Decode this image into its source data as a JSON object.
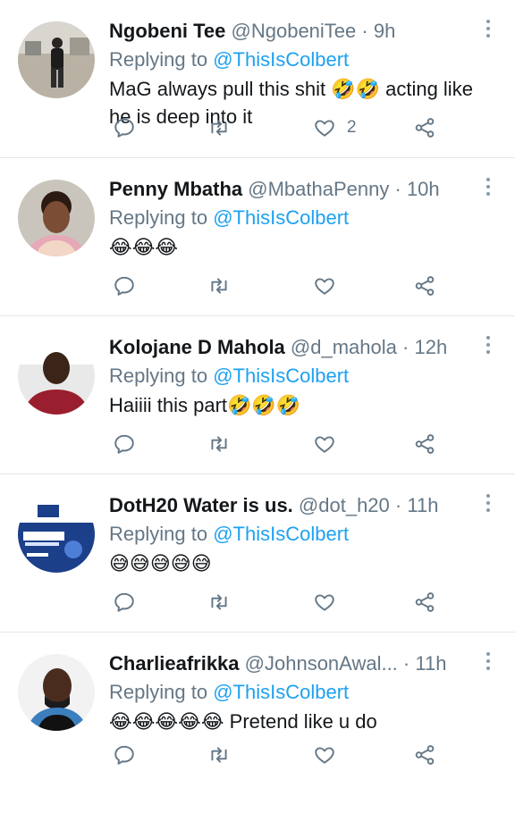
{
  "tweets": [
    {
      "name": "Ngobeni Tee",
      "handle": "@NgobeniTee",
      "separator": "·",
      "time": "9h",
      "replying_prefix": "Replying to",
      "replying_to": "@ThisIsColbert",
      "text": "MaG always pull this shit 🤣🤣 acting like he is deep into it",
      "like_count": "2"
    },
    {
      "name": "Penny Mbatha",
      "handle": "@MbathaPenny",
      "separator": "·",
      "time": "10h",
      "replying_prefix": "Replying to",
      "replying_to": "@ThisIsColbert",
      "text": "😂😂😂",
      "like_count": ""
    },
    {
      "name": "Kolojane D Mahola",
      "handle": "@d_mahola",
      "separator": "·",
      "time": "12h",
      "replying_prefix": "Replying to",
      "replying_to": "@ThisIsColbert",
      "text": "Haiiii this part🤣🤣🤣",
      "like_count": ""
    },
    {
      "name": "DotH20 Water is us.",
      "handle": "@dot_h20",
      "separator": "·",
      "time": "11h",
      "replying_prefix": "Replying to",
      "replying_to": "@ThisIsColbert",
      "text": "😅😅😅😅😅",
      "like_count": ""
    },
    {
      "name": "Charlieafrikka",
      "handle": "@JohnsonAwal...",
      "separator": "·",
      "time": "11h",
      "replying_prefix": "Replying to",
      "replying_to": "@ThisIsColbert",
      "text": "😂😂😂😂😂 Pretend like u do",
      "like_count": ""
    }
  ],
  "icons": {
    "reply": "reply-icon",
    "retweet": "retweet-icon",
    "like": "heart-icon",
    "share": "share-icon",
    "more": "more-vertical-icon"
  },
  "colors": {
    "mention": "#1da1f2",
    "secondary_text": "#657786",
    "divider": "#e1e8ed"
  }
}
